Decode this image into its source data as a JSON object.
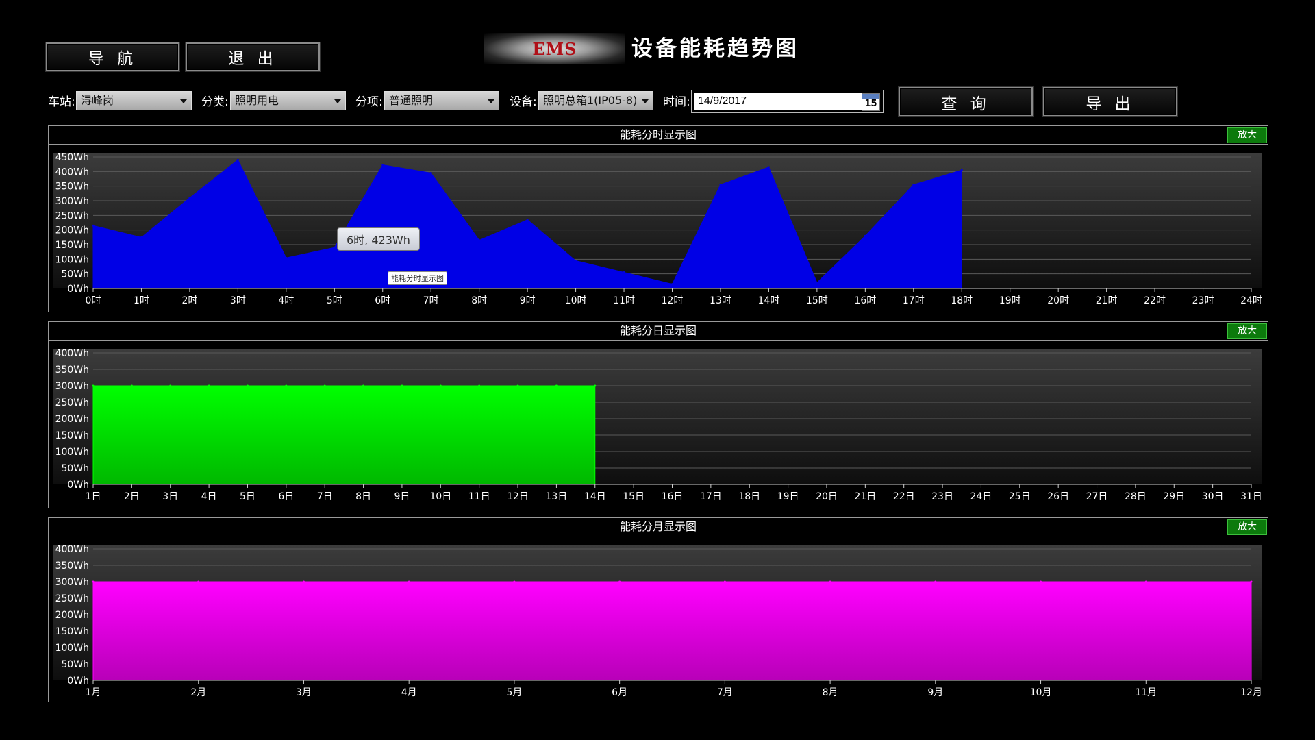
{
  "nav": {
    "nav_label": "导 航",
    "exit_label": "退 出"
  },
  "header": {
    "logo_text": "EMS",
    "title": "设备能耗趋势图"
  },
  "filters": {
    "station_label": "车站:",
    "station_value": "浔峰岗",
    "category_label": "分类:",
    "category_value": "照明用电",
    "subitem_label": "分项:",
    "subitem_value": "普通照明",
    "device_label": "设备:",
    "device_value": "照明总箱1(IP05-8)",
    "time_label": "时间:",
    "time_value": "14/9/2017",
    "calendar_day": "15",
    "query_label": "查 询",
    "export_label": "导 出"
  },
  "zoom_label": "放大",
  "tooltip": {
    "text": "6时, 423Wh",
    "series_text": "能耗分时显示图"
  },
  "chart_data": [
    {
      "type": "area",
      "title": "能耗分时显示图",
      "color": "#0000e6",
      "categories": [
        "0时",
        "1时",
        "2时",
        "3时",
        "4时",
        "5时",
        "6时",
        "7时",
        "8时",
        "9时",
        "10时",
        "11时",
        "12时",
        "13时",
        "14时",
        "15时",
        "16时",
        "17时",
        "18时",
        "19时",
        "20时",
        "21时",
        "22时",
        "23时",
        "24时"
      ],
      "values": [
        215,
        175,
        310,
        440,
        105,
        140,
        423,
        395,
        165,
        235,
        95,
        55,
        15,
        355,
        415,
        20,
        180,
        355,
        405
      ],
      "yticks": [
        "0Wh",
        "50Wh",
        "100Wh",
        "150Wh",
        "200Wh",
        "250Wh",
        "300Wh",
        "350Wh",
        "400Wh",
        "450Wh"
      ],
      "ylim": [
        0,
        450
      ]
    },
    {
      "type": "area",
      "title": "能耗分日显示图",
      "color": "#00ff00",
      "categories": [
        "1日",
        "2日",
        "3日",
        "4日",
        "5日",
        "6日",
        "7日",
        "8日",
        "9日",
        "10日",
        "11日",
        "12日",
        "13日",
        "14日",
        "15日",
        "16日",
        "17日",
        "18日",
        "19日",
        "20日",
        "21日",
        "22日",
        "23日",
        "24日",
        "25日",
        "26日",
        "27日",
        "28日",
        "29日",
        "30日",
        "31日"
      ],
      "values": [
        300,
        300,
        300,
        300,
        300,
        300,
        300,
        300,
        300,
        300,
        300,
        300,
        300,
        300
      ],
      "yticks": [
        "0Wh",
        "50Wh",
        "100Wh",
        "150Wh",
        "200Wh",
        "250Wh",
        "300Wh",
        "350Wh",
        "400Wh"
      ],
      "ylim": [
        0,
        400
      ]
    },
    {
      "type": "area",
      "title": "能耗分月显示图",
      "color": "#ff00ff",
      "categories": [
        "1月",
        "2月",
        "3月",
        "4月",
        "5月",
        "6月",
        "7月",
        "8月",
        "9月",
        "10月",
        "11月",
        "12月"
      ],
      "values": [
        300,
        300,
        300,
        300,
        300,
        300,
        300,
        300,
        300,
        300,
        300,
        300
      ],
      "yticks": [
        "0Wh",
        "50Wh",
        "100Wh",
        "150Wh",
        "200Wh",
        "250Wh",
        "300Wh",
        "350Wh",
        "400Wh"
      ],
      "ylim": [
        0,
        400
      ]
    }
  ]
}
